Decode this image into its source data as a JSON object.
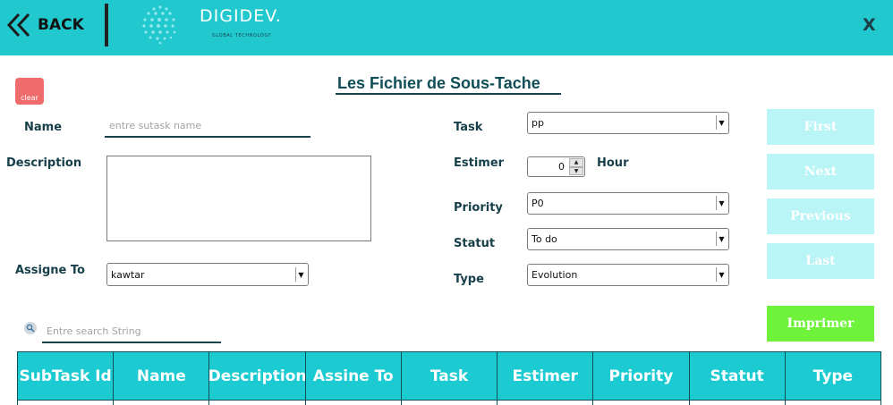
{
  "header": {
    "back_label": "BACK",
    "logo_text": "DIGIDEV.",
    "logo_subtext": "GLOBAL TECHNOLOGY",
    "close_label": "X"
  },
  "page_title": "Les Fichier de Sous-Tache",
  "clear_label": "clear",
  "form": {
    "name_label": "Name",
    "name_placeholder": "entre sutask name",
    "description_label": "Description",
    "assigne_label": "Assigne To",
    "assigne_value": "kawtar",
    "task_label": "Task",
    "task_value": "pp",
    "estimer_label": "Estimer",
    "estimer_value": "0",
    "hour_label": "Hour",
    "priority_label": "Priority",
    "priority_value": "P0",
    "statut_label": "Statut",
    "statut_value": "To do",
    "type_label": "Type",
    "type_value": "Evolution"
  },
  "nav": {
    "first": "First",
    "next": "Next",
    "previous": "Previous",
    "last": "Last",
    "print": "Imprimer"
  },
  "search": {
    "placeholder": "Entre search String"
  },
  "table": {
    "columns": [
      "SubTask Id",
      "Name",
      "Description",
      "Assine To",
      "Task",
      "Estimer",
      "Priority",
      "Statut",
      "Type"
    ]
  },
  "colors": {
    "header_bg": "#21c8ce",
    "nav_btn_bg": "#b9f4f6",
    "print_btn_bg": "#6ef33a",
    "clear_btn_bg": "#ee6c6c",
    "table_header_bg": "#1ccbd2"
  }
}
